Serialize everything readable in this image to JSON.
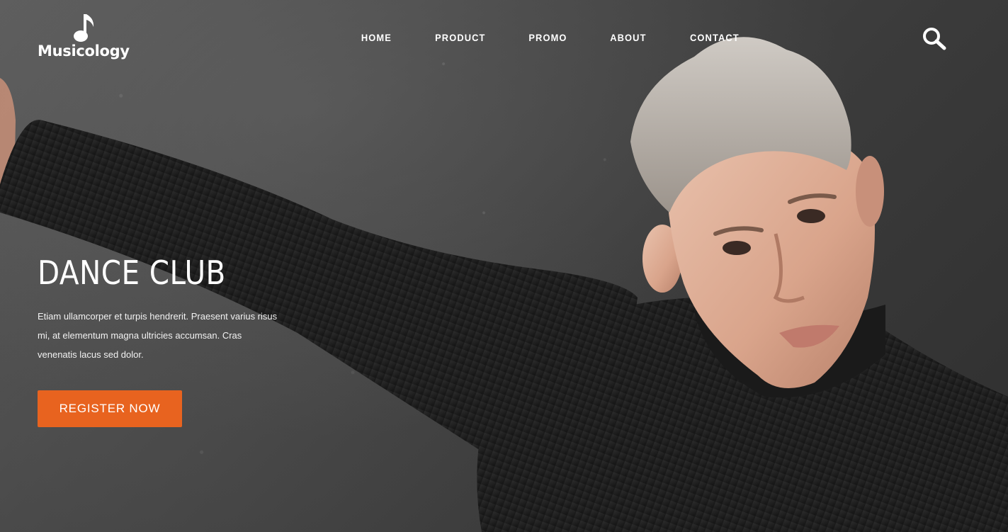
{
  "brand": {
    "name": "Musicology",
    "logo_icon": "music-note-icon"
  },
  "nav": {
    "items": [
      {
        "label": "HOME"
      },
      {
        "label": "PRODUCT"
      },
      {
        "label": "PROMO"
      },
      {
        "label": "ABOUT"
      },
      {
        "label": "CONTACT"
      }
    ],
    "search_icon": "search-icon"
  },
  "hero": {
    "title": "DANCE CLUB",
    "description": "Etiam ullamcorper et turpis hendrerit. Praesent varius risus mi, at elementum magna ultricies accumsan. Cras venenatis lacus sed dolor.",
    "cta_label": "REGISTER NOW"
  },
  "colors": {
    "accent": "#e8631f",
    "text": "#ffffff",
    "background": "#3a3a3a"
  }
}
